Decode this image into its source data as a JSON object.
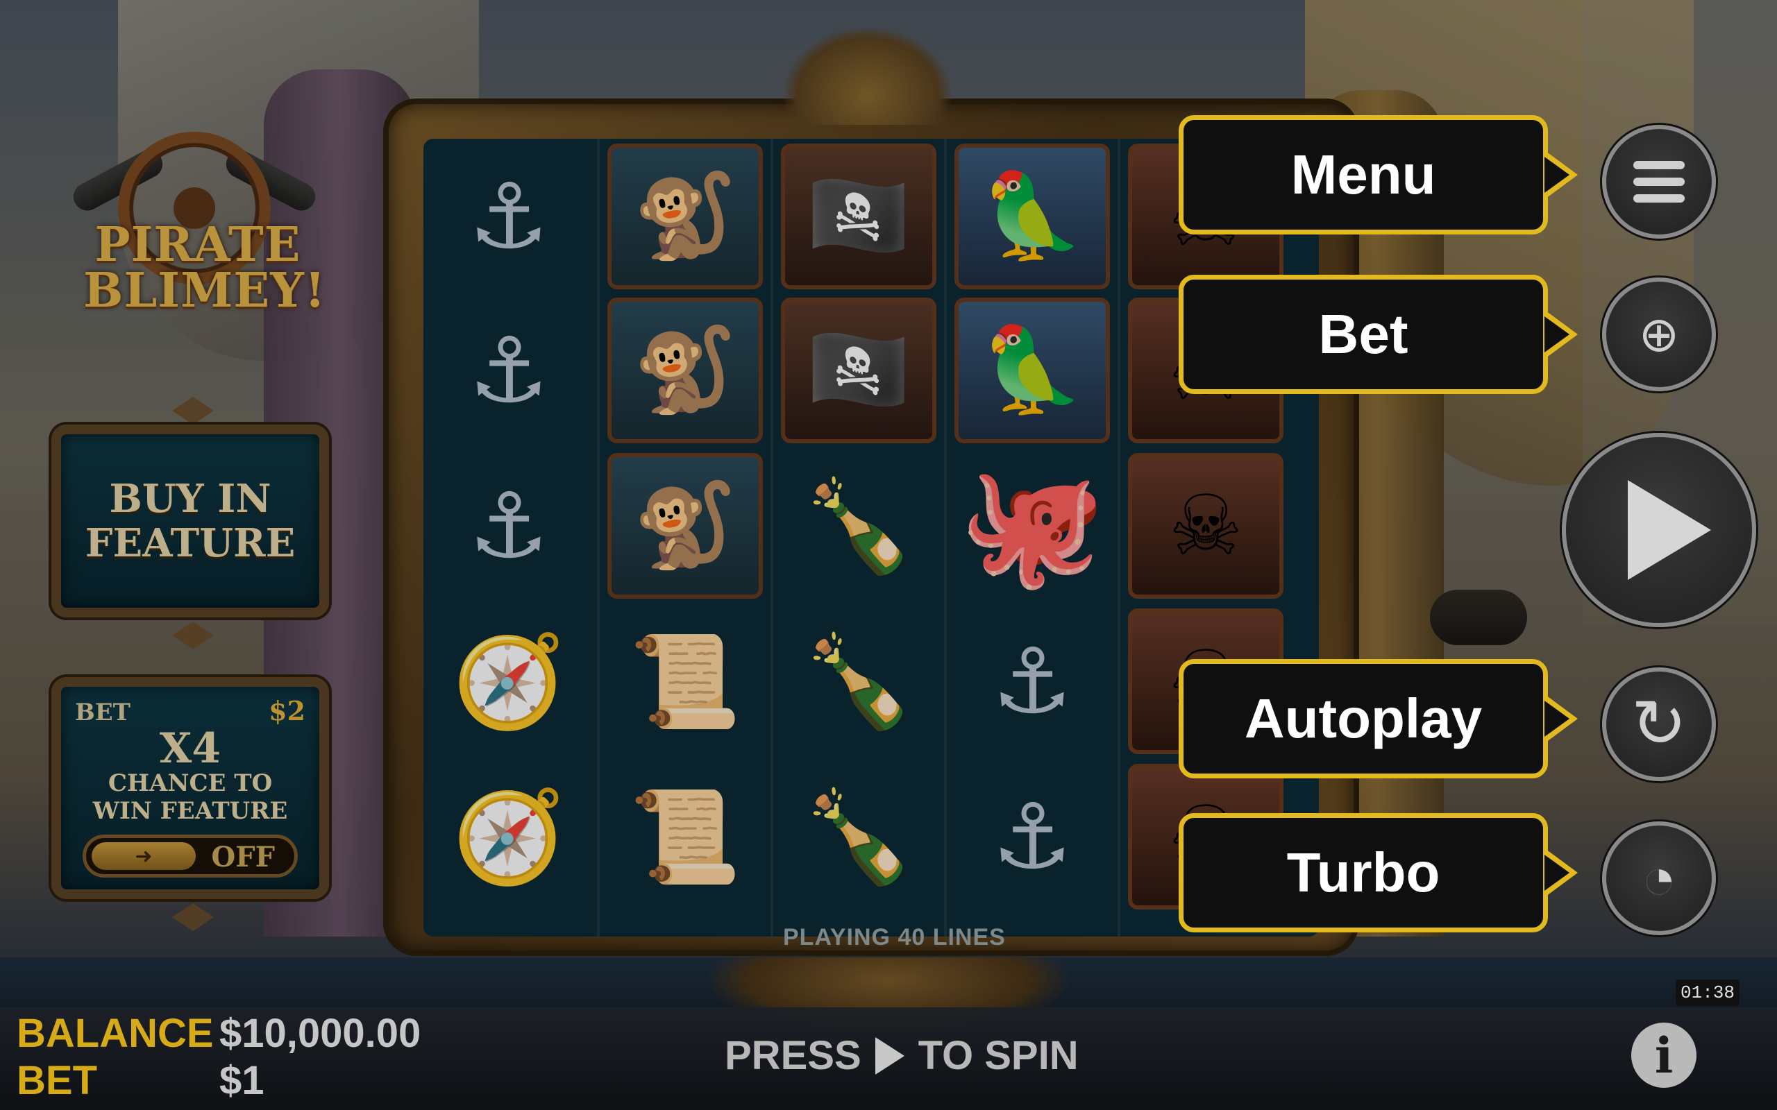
{
  "game": {
    "logo_line1": "PIRATE",
    "logo_line2": "BLIMEY!"
  },
  "buy_feature": {
    "label_line1": "BUY IN",
    "label_line2": "FEATURE"
  },
  "bet_feature": {
    "bet_label": "BET",
    "bet_value": "$2",
    "multiplier": "X4",
    "chance_line1": "CHANCE TO",
    "chance_line2": "WIN FEATURE",
    "toggle_state": "OFF"
  },
  "reels": {
    "columns": [
      [
        "anchor",
        "anchor",
        "anchor",
        "compass",
        "compass"
      ],
      [
        "monkey",
        "monkey",
        "monkey",
        "treasure-map",
        "treasure-map"
      ],
      [
        "captain",
        "captain",
        "rum-bottle",
        "rum-bottle",
        "rum-bottle"
      ],
      [
        "parrot",
        "parrot",
        "golden-octopus",
        "anchor",
        "anchor"
      ],
      [
        "lady-pirate",
        "lady-pirate",
        "lady-pirate",
        "lady-pirate",
        "lady-pirate"
      ]
    ],
    "lines_text": "PLAYING 40 LINES"
  },
  "callouts": {
    "menu": "Menu",
    "bet": "Bet",
    "autoplay": "Autoplay",
    "turbo": "Turbo"
  },
  "controls": {
    "menu_icon": "hamburger-icon",
    "bet_icon": "coin-plus-minus-icon",
    "spin_icon": "play-icon",
    "autoplay_icon": "autoplay-icon",
    "turbo_icon": "speedometer-icon",
    "info_icon": "info-icon"
  },
  "status": {
    "balance_label": "BALANCE",
    "balance_value": "$10,000.00",
    "bet_label": "BET",
    "bet_value": "$1",
    "press_prefix": "PRESS",
    "press_suffix": "TO SPIN",
    "timer": "01:38"
  },
  "colors": {
    "accent_gold": "#e2ba1e",
    "label_gold": "#d7aa18",
    "panel_teal": "#0e3744"
  }
}
